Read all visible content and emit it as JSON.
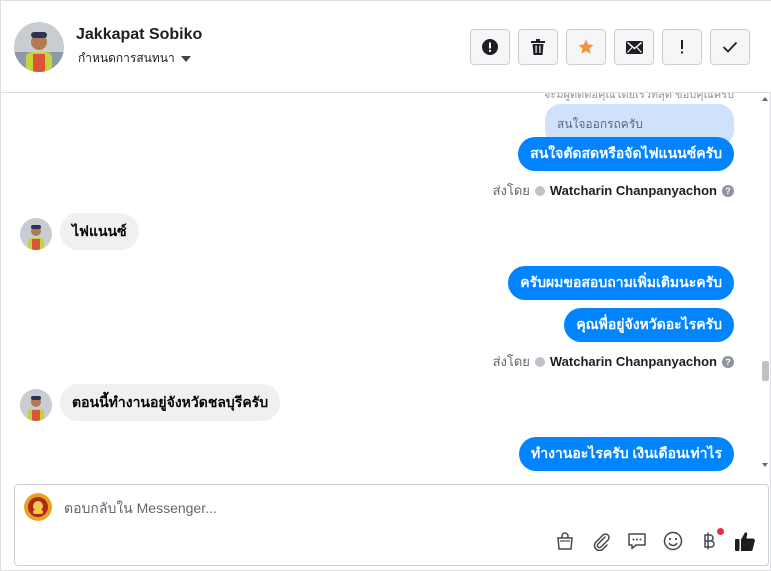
{
  "header": {
    "contact_name": "Jakkapat Sobiko",
    "label_select": "กำหนดการสนทนา",
    "toolbar": [
      {
        "name": "info-button",
        "icon": "exclamation-circle-icon"
      },
      {
        "name": "delete-button",
        "icon": "trash-icon"
      },
      {
        "name": "star-button",
        "icon": "star-icon",
        "color": "#f7923b"
      },
      {
        "name": "mark-unread-button",
        "icon": "envelope-icon"
      },
      {
        "name": "spam-button",
        "icon": "exclamation-icon"
      },
      {
        "name": "mark-done-button",
        "icon": "check-icon"
      }
    ]
  },
  "chat": {
    "cut_text": "จะมีผู้ติดต่อคุณโดยเร็วที่สุด ขอบคุณครับ",
    "reply_quote": "สนใจออกรถครับ",
    "messages": [
      {
        "dir": "out",
        "text": "สนใจตัดสดหรือจัดไฟแนนซ์ครับ"
      },
      {
        "dir": "sentby",
        "prefix": "ส่งโดย",
        "who": "Watcharin Chanpanyachon"
      },
      {
        "dir": "in",
        "text": "ไฟแนนซ์"
      },
      {
        "dir": "out",
        "text": "ครับผมขอสอบถามเพิ่มเติมนะครับ"
      },
      {
        "dir": "out",
        "text": "คุณพื่อยู่จังหวัดอะไรครับ"
      },
      {
        "dir": "sentby",
        "prefix": "ส่งโดย",
        "who": "Watcharin Chanpanyachon"
      },
      {
        "dir": "in",
        "text": "ตอนนี้ทำงานอยู่จังหวัดชลบุรีครับ"
      },
      {
        "dir": "out",
        "text": "ทำงานอะไรครับ เงินเดือนเท่าไร"
      }
    ]
  },
  "composer": {
    "placeholder": "ตอบกลับใน Messenger...",
    "value": "",
    "tools": [
      "bag-icon",
      "paperclip-icon",
      "saved-reply-icon",
      "emoji-icon",
      "baht-icon",
      "thumbs-up-icon"
    ]
  },
  "colors": {
    "outgoing": "#0084ff",
    "incoming": "#f0f0f0",
    "quote": "#cfe1fb",
    "star": "#f7923b",
    "notification_dot": "#f02849"
  }
}
